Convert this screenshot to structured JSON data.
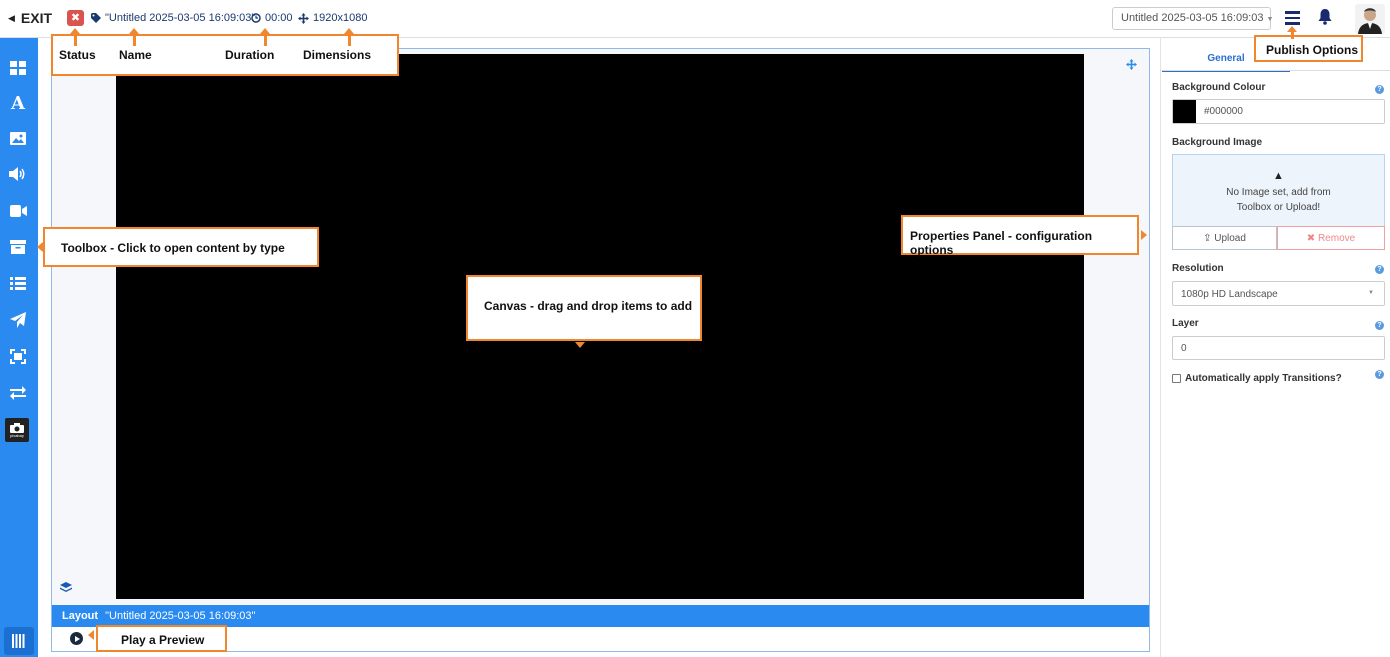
{
  "topbar": {
    "exit_label": "EXIT",
    "layout_name": "\"Untitled 2025-03-05 16:09:03\"",
    "duration": "00:00",
    "dimensions": "1920x1080",
    "layout_select_value": "Untitled 2025-03-05 16:09:03"
  },
  "sidebar": {
    "items": [
      "layouts-icon",
      "text-icon",
      "image-icon",
      "audio-icon",
      "video-icon",
      "archive-icon",
      "list-icon",
      "send-icon",
      "fullscreen-icon",
      "swap-icon",
      "pixabay-icon"
    ],
    "pixabay_label": "pixabay"
  },
  "layout_bar": {
    "label": "Layout",
    "name": "\"Untitled 2025-03-05 16:09:03\""
  },
  "properties": {
    "tab_general": "General",
    "background_colour_label": "Background Colour",
    "background_colour_value": "#000000",
    "background_image_label": "Background Image",
    "no_image_line1": "No Image set, add from",
    "no_image_line2": "Toolbox or Upload!",
    "upload_label": "Upload",
    "remove_label": "Remove",
    "resolution_label": "Resolution",
    "resolution_value": "1080p HD Landscape",
    "layer_label": "Layer",
    "layer_value": "0",
    "transitions_label": "Automatically apply Transitions?"
  },
  "annotations": {
    "status": "Status",
    "name": "Name",
    "duration": "Duration",
    "dimensions": "Dimensions",
    "publish": "Publish Options",
    "toolbox": "Toolbox - Click to open content by type",
    "properties": "Properties Panel - configuration options",
    "canvas": "Canvas - drag and drop items to add",
    "preview": "Play a Preview"
  },
  "colors": {
    "accent": "#2a8af0",
    "annotation": "#f0872e",
    "status_red": "#d9534f",
    "canvas_bg": "#000000"
  }
}
